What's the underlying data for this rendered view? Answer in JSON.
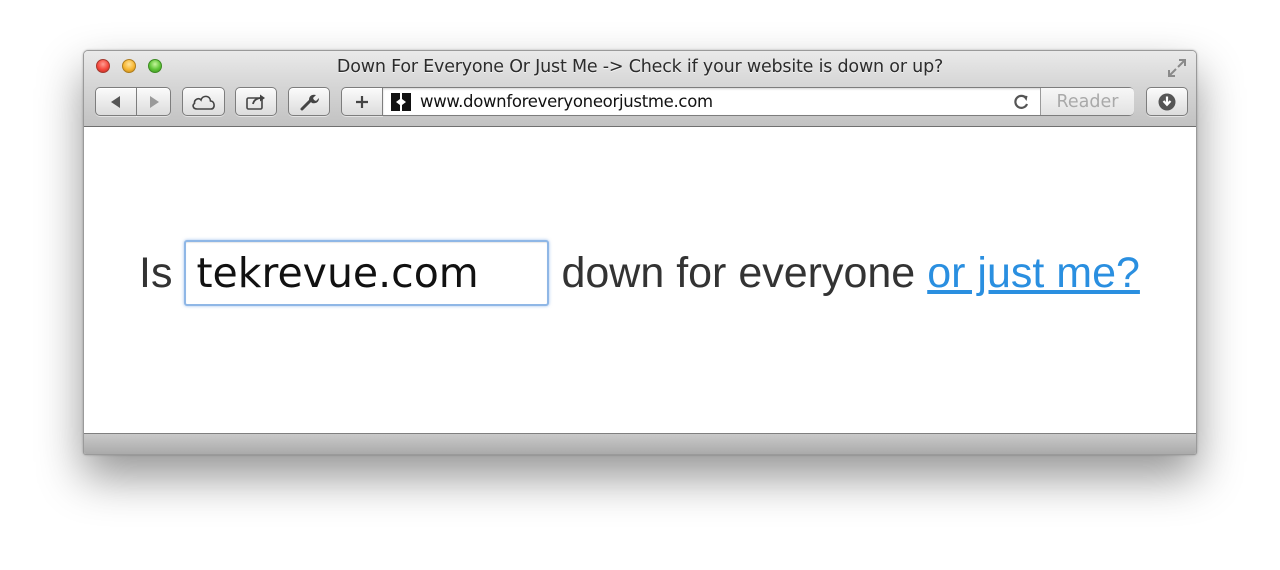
{
  "window": {
    "title": "Down For Everyone Or Just Me -> Check if your website is down or up?"
  },
  "toolbar": {
    "back_icon": "back-arrow-icon",
    "forward_icon": "forward-arrow-icon",
    "icloud_icon": "cloud-icon",
    "share_icon": "share-icon",
    "tools_icon": "wrench-icon",
    "add_icon": "plus-icon",
    "download_icon": "download-icon"
  },
  "address_bar": {
    "url": "www.downforeveryoneorjustme.com",
    "favicon": "site-favicon",
    "reload_icon": "reload-icon",
    "reader_label": "Reader"
  },
  "page": {
    "prefix": "Is",
    "domain_value": "tekrevue.com",
    "middle": "down for everyone",
    "link": "or just me?"
  },
  "colors": {
    "link": "#2a8fe0",
    "text": "#333333",
    "input_focus": "#8fb7e6"
  }
}
